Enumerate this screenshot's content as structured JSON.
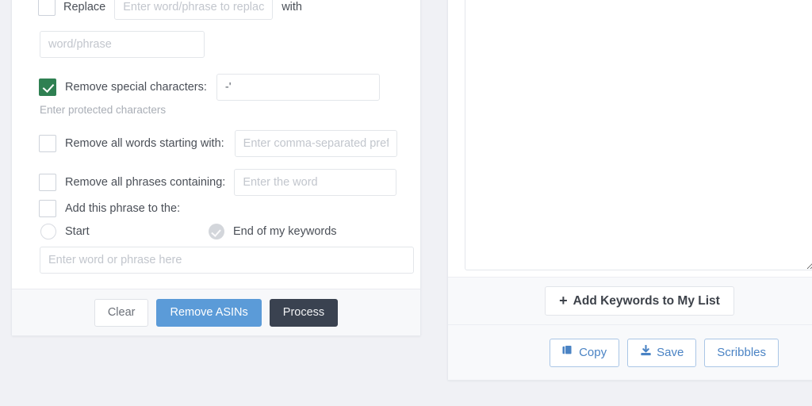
{
  "page": {
    "background": "#f0f1f5"
  },
  "colors": {
    "accent_blue": "#5b9bd8",
    "dark_button": "#3a4250",
    "checkbox_green": "#2f8052",
    "link_blue": "#4a83c4",
    "pill_blue": "#4368d8"
  },
  "left_panel": {
    "replace_row": {
      "checkbox_label": "Replace",
      "checkbox_checked": false,
      "input_placeholder": "Enter word/phrase to replace",
      "input_value": "",
      "with_label": "with",
      "second_input_placeholder": "word/phrase",
      "second_input_value": ""
    },
    "special_chars_row": {
      "label": "Remove special characters:",
      "checked": true,
      "input_value": "-'",
      "input_placeholder": "",
      "hint": "Enter protected characters"
    },
    "prefix_row": {
      "label": "Remove all words starting with:",
      "checked": false,
      "input_placeholder": "Enter comma-separated prefixes",
      "input_value": ""
    },
    "phrase_row": {
      "label": "Remove all phrases containing:",
      "checked": false,
      "input_placeholder": "Enter the word",
      "input_value": ""
    },
    "add_phrase_row": {
      "label": "Add this phrase to the:",
      "checked": false,
      "option_start": "Start",
      "option_end": "End of my keywords",
      "selected_option": "End of my keywords",
      "input_placeholder": "Enter word or phrase here",
      "input_value": ""
    },
    "footer_buttons": {
      "clear": "Clear",
      "remove_asins": "Remove ASINs",
      "process": "Process"
    }
  },
  "right_panel": {
    "textarea_value": "",
    "textarea_placeholder": "",
    "add_keywords_button": {
      "plus": "+",
      "label": "Add Keywords to My List"
    },
    "footer_buttons": [
      {
        "label": "Copy",
        "icon": "copy-icon"
      },
      {
        "label": "Save",
        "icon": "download-icon"
      },
      {
        "label": "Scribbles",
        "icon": "none"
      }
    ]
  }
}
